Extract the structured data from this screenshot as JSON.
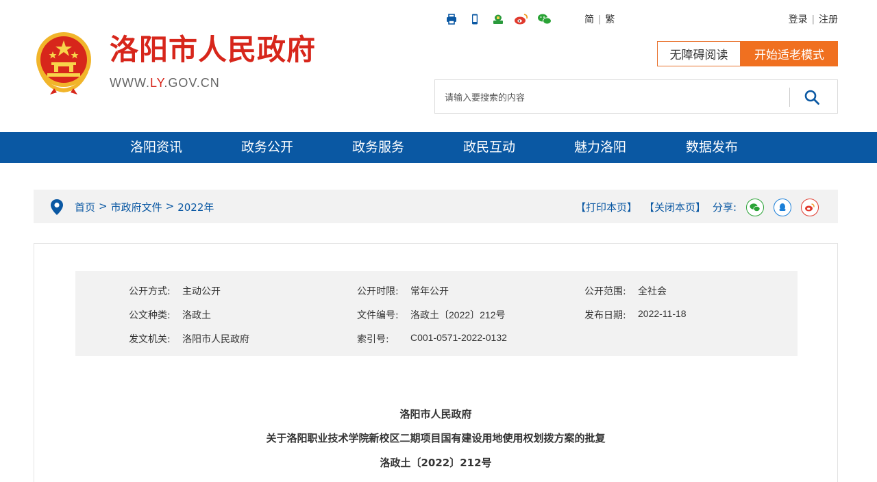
{
  "header": {
    "title": "洛阳市人民政府",
    "url_prefix": "WWW.",
    "url_highlight": "LY",
    "url_suffix": ".GOV.CN",
    "top_icons": [
      "print-icon",
      "mobile-icon",
      "government-app-icon",
      "weibo-icon",
      "wechat-icon"
    ],
    "lang": {
      "simplified": "简",
      "traditional": "繁"
    },
    "auth": {
      "login": "登录",
      "register": "注册"
    },
    "accessible_label": "无障碍阅读",
    "elder_mode_label": "开始适老模式",
    "search": {
      "placeholder": "请输入要搜索的内容",
      "value": ""
    }
  },
  "nav": {
    "items": [
      "洛阳资讯",
      "政务公开",
      "政务服务",
      "政民互动",
      "魅力洛阳",
      "数据发布"
    ]
  },
  "breadcrumb": {
    "home": "首页",
    "level1": "市政府文件",
    "level2": "2022年",
    "separator": ">",
    "print": "【打印本页】",
    "close": "【关闭本页】",
    "share_label": "分享:"
  },
  "meta": {
    "disclosure_method": {
      "label": "公开方式:",
      "value": "主动公开"
    },
    "disclosure_period": {
      "label": "公开时限:",
      "value": "常年公开"
    },
    "disclosure_scope": {
      "label": "公开范围:",
      "value": "全社会"
    },
    "doc_type": {
      "label": "公文种类:",
      "value": "洛政土"
    },
    "doc_number": {
      "label": "文件编号:",
      "value": "洛政土〔2022〕212号"
    },
    "publish_date": {
      "label": "发布日期:",
      "value": "2022-11-18"
    },
    "issuer": {
      "label": "发文机关:",
      "value": "洛阳市人民政府"
    },
    "index_no": {
      "label": "索引号:",
      "value": "C001-0571-2022-0132"
    }
  },
  "document": {
    "issuer": "洛阳市人民政府",
    "title": "关于洛阳职业技术学院新校区二期项目国有建设用地使用权划拨方案的批复",
    "number": "洛政土〔2022〕212号"
  },
  "colors": {
    "brand_red": "#d7261b",
    "nav_blue": "#0a58a3",
    "elder_orange": "#f07020"
  }
}
